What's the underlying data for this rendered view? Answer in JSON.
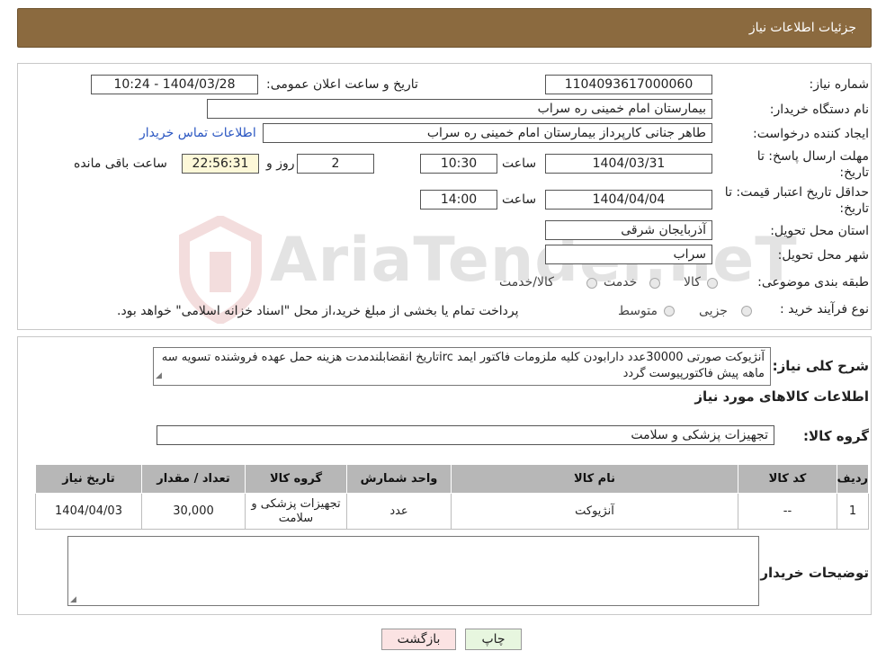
{
  "header": {
    "title": "جزئیات اطلاعات نیاز"
  },
  "fields": {
    "need_number_label": "شماره نیاز:",
    "need_number": "1104093617000060",
    "announce_label": "تاریخ و ساعت اعلان عمومی:",
    "announce_value": "1404/03/28 - 10:24",
    "buyer_org_label": "نام دستگاه خریدار:",
    "buyer_org": "بیمارستان امام خمینی ره  سراب",
    "requester_label": "ایجاد کننده درخواست:",
    "requester": "طاهر جنانی کارپرداز بیمارستان امام خمینی ره  سراب",
    "contact_link": "اطلاعات تماس خریدار",
    "reply_deadline_label_1": "مهلت ارسال پاسخ: تا",
    "reply_deadline_label_2": "تاریخ:",
    "reply_date": "1404/03/31",
    "time_label": "ساعت",
    "reply_time": "10:30",
    "days_value": "2",
    "days_label": "روز و",
    "remaining_time": "22:56:31",
    "remaining_label": "ساعت باقی مانده",
    "price_validity_label_1": "حداقل تاریخ اعتبار قیمت: تا",
    "price_validity_label_2": "تاریخ:",
    "validity_date": "1404/04/04",
    "validity_time": "14:00",
    "province_label": "استان محل تحویل:",
    "province": "آذربایجان شرقی",
    "city_label": "شهر محل تحویل:",
    "city": "سراب",
    "category_label": "طبقه بندی موضوعی:",
    "category_options": [
      "کالا",
      "خدمت",
      "کالا/خدمت"
    ],
    "process_label": "نوع فرآیند خرید :",
    "process_options": [
      "جزیی",
      "متوسط"
    ],
    "process_note": "پرداخت تمام یا بخشی از مبلغ خرید،از محل \"اسناد خزانه اسلامی\" خواهد بود."
  },
  "description": {
    "label": "شرح کلی نیاز:",
    "text": "آنژیوکت صورتی 30000عدد دارابودن کلیه ملزومات فاکتور ایمد ircتاریخ انقضابلندمدت هزینه حمل عهده فروشنده تسویه سه ماهه پیش فاکتورپیوست گردد"
  },
  "goods_section": {
    "title": "اطلاعات کالاهای مورد نیاز",
    "group_label": "گروه کالا:",
    "group_value": "تجهیزات پزشکی و سلامت"
  },
  "table": {
    "headers": [
      "ردیف",
      "کد کالا",
      "نام کالا",
      "واحد شمارش",
      "گروه کالا",
      "تعداد / مقدار",
      "تاریخ نیاز"
    ],
    "rows": [
      [
        "1",
        "--",
        "آنژیوکت",
        "عدد",
        "تجهیزات پزشکی و سلامت",
        "30,000",
        "1404/04/03"
      ]
    ]
  },
  "notes": {
    "label": "توضیحات خریدار:"
  },
  "buttons": {
    "print": "چاپ",
    "back": "بازگشت"
  },
  "watermark": {
    "text": "AriaTender.neT"
  },
  "colors": {
    "header_bg": "#8b6a3f",
    "table_header_bg": "#b7b7b7",
    "link": "#2b57c2"
  }
}
